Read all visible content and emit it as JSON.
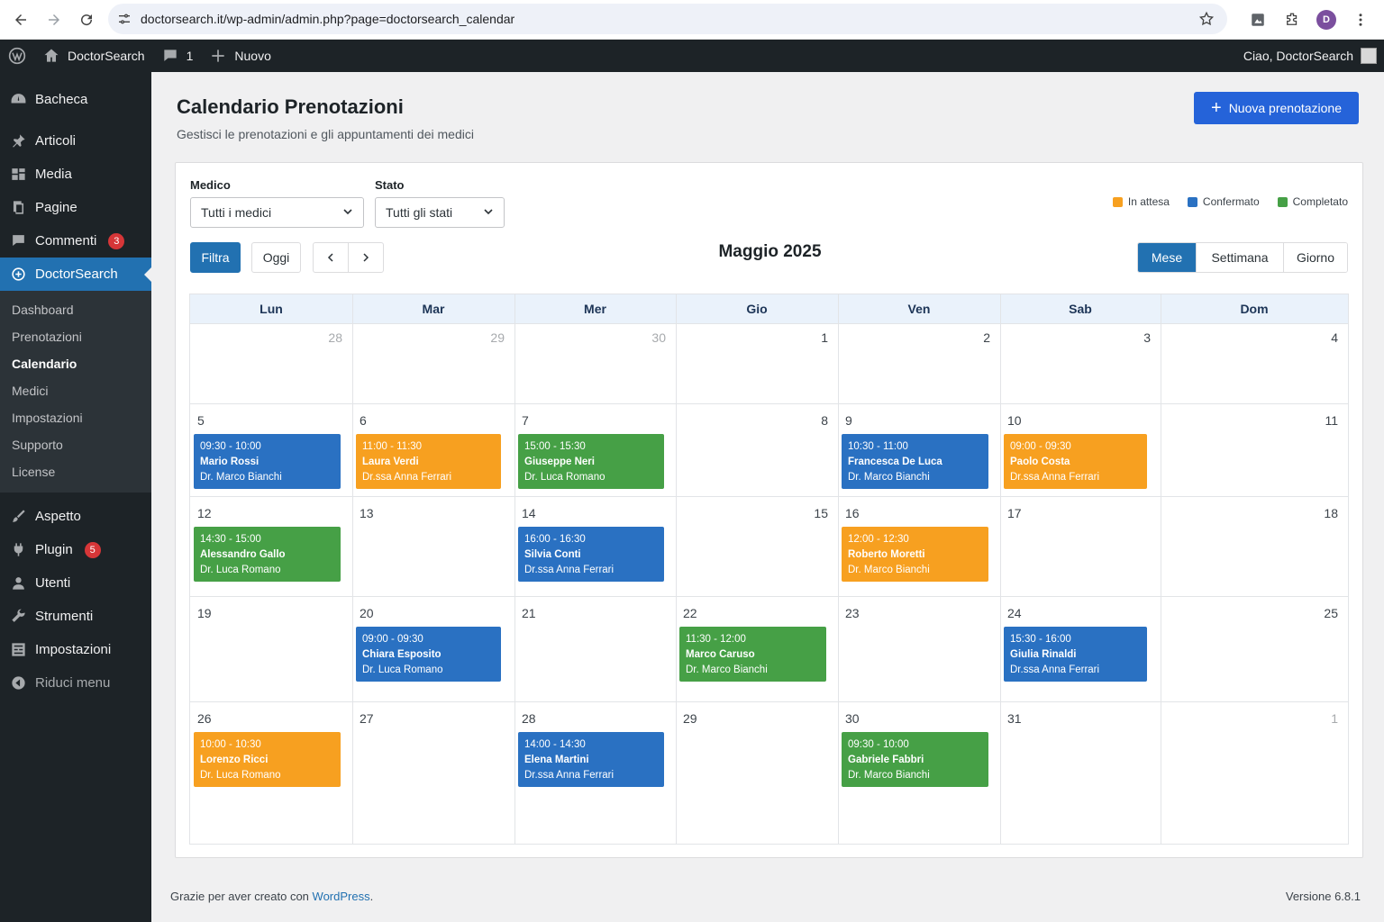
{
  "browser": {
    "url": "doctorsearch.it/wp-admin/admin.php?page=doctorsearch_calendar",
    "profile_initial": "D"
  },
  "adminbar": {
    "site_name": "DoctorSearch",
    "comments_count": "1",
    "new_label": "Nuovo",
    "greeting": "Ciao, DoctorSearch"
  },
  "sidebar": {
    "items": [
      {
        "label": "Bacheca",
        "icon": "dashboard-icon"
      },
      {
        "label": "Articoli",
        "icon": "pin-icon"
      },
      {
        "label": "Media",
        "icon": "media-icon"
      },
      {
        "label": "Pagine",
        "icon": "pages-icon"
      },
      {
        "label": "Commenti",
        "icon": "comment-icon",
        "count": "3"
      },
      {
        "label": "DoctorSearch",
        "icon": "plus-circle-icon",
        "active": true
      }
    ],
    "submenu": [
      "Dashboard",
      "Prenotazioni",
      "Calendario",
      "Medici",
      "Impostazioni",
      "Supporto",
      "License"
    ],
    "submenu_current": "Calendario",
    "items2": [
      {
        "label": "Aspetto",
        "icon": "brush-icon"
      },
      {
        "label": "Plugin",
        "icon": "plugin-icon",
        "count": "5"
      },
      {
        "label": "Utenti",
        "icon": "user-icon"
      },
      {
        "label": "Strumenti",
        "icon": "wrench-icon"
      },
      {
        "label": "Impostazioni",
        "icon": "settings-icon"
      }
    ],
    "collapse_label": "Riduci menu"
  },
  "page": {
    "title": "Calendario Prenotazioni",
    "subtitle": "Gestisci le prenotazioni e gli appuntamenti dei medici",
    "new_button": "Nuova prenotazione"
  },
  "filters": {
    "doctor_label": "Medico",
    "doctor_value": "Tutti i medici",
    "status_label": "Stato",
    "status_value": "Tutti gli stati",
    "filter_button": "Filtra",
    "today_button": "Oggi",
    "prev": "<",
    "next": ">"
  },
  "legend": [
    {
      "label": "In attesa",
      "color": "#f7a020"
    },
    {
      "label": "Confermato",
      "color": "#2a71c2"
    },
    {
      "label": "Completato",
      "color": "#46a046"
    }
  ],
  "calendar": {
    "month_title": "Maggio 2025",
    "views": [
      "Mese",
      "Settimana",
      "Giorno"
    ],
    "active_view": "Mese",
    "weekdays": [
      "Lun",
      "Mar",
      "Mer",
      "Gio",
      "Ven",
      "Sab",
      "Dom"
    ],
    "weeks": [
      [
        {
          "d": "28",
          "other": true
        },
        {
          "d": "29",
          "other": true
        },
        {
          "d": "30",
          "other": true
        },
        {
          "d": "1"
        },
        {
          "d": "2"
        },
        {
          "d": "3"
        },
        {
          "d": "4"
        }
      ],
      [
        {
          "d": "5"
        },
        {
          "d": "6"
        },
        {
          "d": "7"
        },
        {
          "d": "8"
        },
        {
          "d": "9"
        },
        {
          "d": "10"
        },
        {
          "d": "11"
        }
      ],
      [
        {
          "d": "12"
        },
        {
          "d": "13"
        },
        {
          "d": "14"
        },
        {
          "d": "15"
        },
        {
          "d": "16"
        },
        {
          "d": "17"
        },
        {
          "d": "18"
        }
      ],
      [
        {
          "d": "19"
        },
        {
          "d": "20"
        },
        {
          "d": "21"
        },
        {
          "d": "22"
        },
        {
          "d": "23"
        },
        {
          "d": "24"
        },
        {
          "d": "25"
        }
      ],
      [
        {
          "d": "26"
        },
        {
          "d": "27"
        },
        {
          "d": "28"
        },
        {
          "d": "29"
        },
        {
          "d": "30"
        },
        {
          "d": "31"
        },
        {
          "d": "1",
          "other": true
        }
      ]
    ],
    "events": [
      {
        "week": 1,
        "day": 0,
        "time": "09:30 - 10:00",
        "patient": "Mario Rossi",
        "doctor": "Dr. Marco Bianchi",
        "status": "confirmed"
      },
      {
        "week": 1,
        "day": 1,
        "time": "11:00 - 11:30",
        "patient": "Laura Verdi",
        "doctor": "Dr.ssa Anna Ferrari",
        "status": "pending"
      },
      {
        "week": 1,
        "day": 2,
        "time": "15:00 - 15:30",
        "patient": "Giuseppe Neri",
        "doctor": "Dr. Luca Romano",
        "status": "completed"
      },
      {
        "week": 1,
        "day": 4,
        "time": "10:30 - 11:00",
        "patient": "Francesca De Luca",
        "doctor": "Dr. Marco Bianchi",
        "status": "confirmed"
      },
      {
        "week": 1,
        "day": 5,
        "time": "09:00 - 09:30",
        "patient": "Paolo Costa",
        "doctor": "Dr.ssa Anna Ferrari",
        "status": "pending"
      },
      {
        "week": 2,
        "day": 0,
        "time": "14:30 - 15:00",
        "patient": "Alessandro Gallo",
        "doctor": "Dr. Luca Romano",
        "status": "completed"
      },
      {
        "week": 2,
        "day": 2,
        "time": "16:00 - 16:30",
        "patient": "Silvia Conti",
        "doctor": "Dr.ssa Anna Ferrari",
        "status": "confirmed"
      },
      {
        "week": 2,
        "day": 4,
        "time": "12:00 - 12:30",
        "patient": "Roberto Moretti",
        "doctor": "Dr. Marco Bianchi",
        "status": "pending"
      },
      {
        "week": 3,
        "day": 1,
        "time": "09:00 - 09:30",
        "patient": "Chiara Esposito",
        "doctor": "Dr. Luca Romano",
        "status": "confirmed"
      },
      {
        "week": 3,
        "day": 3,
        "time": "11:30 - 12:00",
        "patient": "Marco Caruso",
        "doctor": "Dr. Marco Bianchi",
        "status": "completed"
      },
      {
        "week": 3,
        "day": 5,
        "time": "15:30 - 16:00",
        "patient": "Giulia Rinaldi",
        "doctor": "Dr.ssa Anna Ferrari",
        "status": "confirmed"
      },
      {
        "week": 4,
        "day": 0,
        "time": "10:00 - 10:30",
        "patient": "Lorenzo Ricci",
        "doctor": "Dr. Luca Romano",
        "status": "pending"
      },
      {
        "week": 4,
        "day": 2,
        "time": "14:00 - 14:30",
        "patient": "Elena Martini",
        "doctor": "Dr.ssa Anna Ferrari",
        "status": "confirmed"
      },
      {
        "week": 4,
        "day": 4,
        "time": "09:30 - 10:00",
        "patient": "Gabriele Fabbri",
        "doctor": "Dr. Marco Bianchi",
        "status": "completed"
      }
    ]
  },
  "footer": {
    "thanks_prefix": "Grazie per aver creato con ",
    "thanks_link": "WordPress",
    "thanks_suffix": ".",
    "version": "Versione 6.8.1"
  }
}
